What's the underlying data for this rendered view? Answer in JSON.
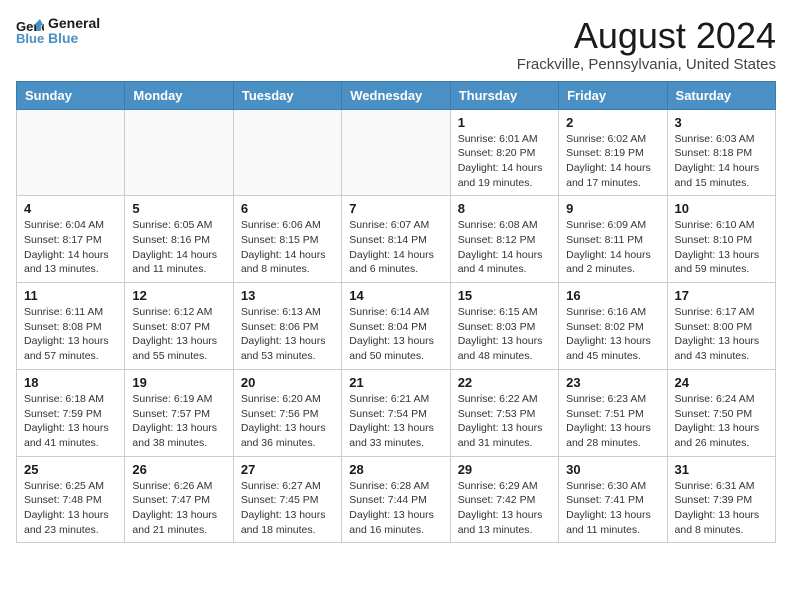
{
  "header": {
    "logo_line1": "General",
    "logo_line2": "Blue",
    "month_year": "August 2024",
    "location": "Frackville, Pennsylvania, United States"
  },
  "weekdays": [
    "Sunday",
    "Monday",
    "Tuesday",
    "Wednesday",
    "Thursday",
    "Friday",
    "Saturday"
  ],
  "weeks": [
    [
      {
        "day": "",
        "info": ""
      },
      {
        "day": "",
        "info": ""
      },
      {
        "day": "",
        "info": ""
      },
      {
        "day": "",
        "info": ""
      },
      {
        "day": "1",
        "info": "Sunrise: 6:01 AM\nSunset: 8:20 PM\nDaylight: 14 hours\nand 19 minutes."
      },
      {
        "day": "2",
        "info": "Sunrise: 6:02 AM\nSunset: 8:19 PM\nDaylight: 14 hours\nand 17 minutes."
      },
      {
        "day": "3",
        "info": "Sunrise: 6:03 AM\nSunset: 8:18 PM\nDaylight: 14 hours\nand 15 minutes."
      }
    ],
    [
      {
        "day": "4",
        "info": "Sunrise: 6:04 AM\nSunset: 8:17 PM\nDaylight: 14 hours\nand 13 minutes."
      },
      {
        "day": "5",
        "info": "Sunrise: 6:05 AM\nSunset: 8:16 PM\nDaylight: 14 hours\nand 11 minutes."
      },
      {
        "day": "6",
        "info": "Sunrise: 6:06 AM\nSunset: 8:15 PM\nDaylight: 14 hours\nand 8 minutes."
      },
      {
        "day": "7",
        "info": "Sunrise: 6:07 AM\nSunset: 8:14 PM\nDaylight: 14 hours\nand 6 minutes."
      },
      {
        "day": "8",
        "info": "Sunrise: 6:08 AM\nSunset: 8:12 PM\nDaylight: 14 hours\nand 4 minutes."
      },
      {
        "day": "9",
        "info": "Sunrise: 6:09 AM\nSunset: 8:11 PM\nDaylight: 14 hours\nand 2 minutes."
      },
      {
        "day": "10",
        "info": "Sunrise: 6:10 AM\nSunset: 8:10 PM\nDaylight: 13 hours\nand 59 minutes."
      }
    ],
    [
      {
        "day": "11",
        "info": "Sunrise: 6:11 AM\nSunset: 8:08 PM\nDaylight: 13 hours\nand 57 minutes."
      },
      {
        "day": "12",
        "info": "Sunrise: 6:12 AM\nSunset: 8:07 PM\nDaylight: 13 hours\nand 55 minutes."
      },
      {
        "day": "13",
        "info": "Sunrise: 6:13 AM\nSunset: 8:06 PM\nDaylight: 13 hours\nand 53 minutes."
      },
      {
        "day": "14",
        "info": "Sunrise: 6:14 AM\nSunset: 8:04 PM\nDaylight: 13 hours\nand 50 minutes."
      },
      {
        "day": "15",
        "info": "Sunrise: 6:15 AM\nSunset: 8:03 PM\nDaylight: 13 hours\nand 48 minutes."
      },
      {
        "day": "16",
        "info": "Sunrise: 6:16 AM\nSunset: 8:02 PM\nDaylight: 13 hours\nand 45 minutes."
      },
      {
        "day": "17",
        "info": "Sunrise: 6:17 AM\nSunset: 8:00 PM\nDaylight: 13 hours\nand 43 minutes."
      }
    ],
    [
      {
        "day": "18",
        "info": "Sunrise: 6:18 AM\nSunset: 7:59 PM\nDaylight: 13 hours\nand 41 minutes."
      },
      {
        "day": "19",
        "info": "Sunrise: 6:19 AM\nSunset: 7:57 PM\nDaylight: 13 hours\nand 38 minutes."
      },
      {
        "day": "20",
        "info": "Sunrise: 6:20 AM\nSunset: 7:56 PM\nDaylight: 13 hours\nand 36 minutes."
      },
      {
        "day": "21",
        "info": "Sunrise: 6:21 AM\nSunset: 7:54 PM\nDaylight: 13 hours\nand 33 minutes."
      },
      {
        "day": "22",
        "info": "Sunrise: 6:22 AM\nSunset: 7:53 PM\nDaylight: 13 hours\nand 31 minutes."
      },
      {
        "day": "23",
        "info": "Sunrise: 6:23 AM\nSunset: 7:51 PM\nDaylight: 13 hours\nand 28 minutes."
      },
      {
        "day": "24",
        "info": "Sunrise: 6:24 AM\nSunset: 7:50 PM\nDaylight: 13 hours\nand 26 minutes."
      }
    ],
    [
      {
        "day": "25",
        "info": "Sunrise: 6:25 AM\nSunset: 7:48 PM\nDaylight: 13 hours\nand 23 minutes."
      },
      {
        "day": "26",
        "info": "Sunrise: 6:26 AM\nSunset: 7:47 PM\nDaylight: 13 hours\nand 21 minutes."
      },
      {
        "day": "27",
        "info": "Sunrise: 6:27 AM\nSunset: 7:45 PM\nDaylight: 13 hours\nand 18 minutes."
      },
      {
        "day": "28",
        "info": "Sunrise: 6:28 AM\nSunset: 7:44 PM\nDaylight: 13 hours\nand 16 minutes."
      },
      {
        "day": "29",
        "info": "Sunrise: 6:29 AM\nSunset: 7:42 PM\nDaylight: 13 hours\nand 13 minutes."
      },
      {
        "day": "30",
        "info": "Sunrise: 6:30 AM\nSunset: 7:41 PM\nDaylight: 13 hours\nand 11 minutes."
      },
      {
        "day": "31",
        "info": "Sunrise: 6:31 AM\nSunset: 7:39 PM\nDaylight: 13 hours\nand 8 minutes."
      }
    ]
  ]
}
